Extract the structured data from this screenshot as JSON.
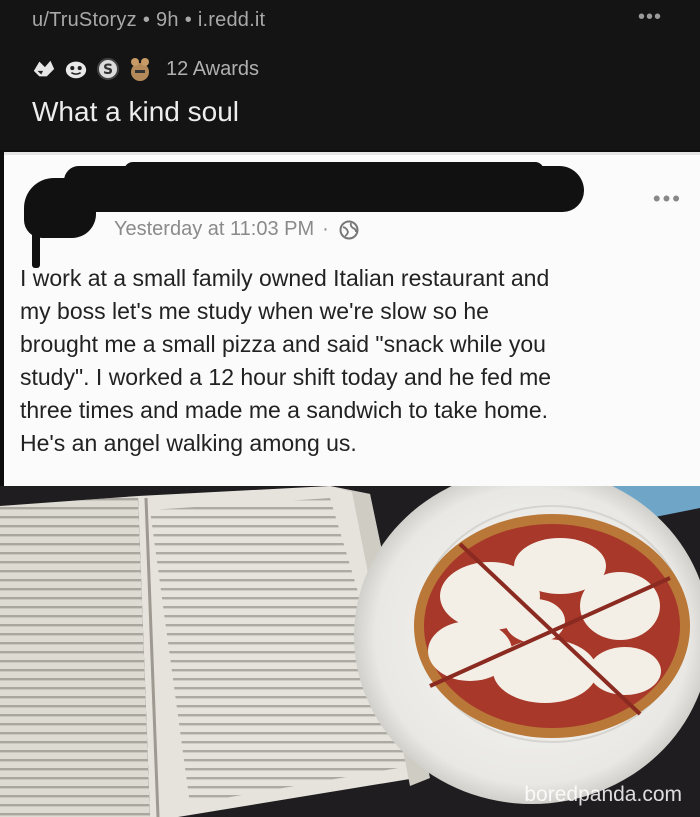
{
  "post": {
    "subreddit_user": "u/TruStoryz",
    "age": "9h",
    "domain": "i.redd.it",
    "awards_label": "12 Awards",
    "title": "What a kind soul",
    "more": "•••"
  },
  "fb_post": {
    "timestamp": "Yesterday at 11:03 PM",
    "separator": "·",
    "more": "•••",
    "body": "I work at a small family owned Italian restaurant and\nmy boss let's me study when we're slow so he\nbrought me a small pizza and said \"snack while you\nstudy\". I worked a 12 hour shift today and he fed me\nthree times and made me a sandwich to take home.\nHe's an angel walking among us."
  },
  "photo": {
    "watermark": "boredpanda.com"
  },
  "icons": [
    "award-icon",
    "award-icon",
    "award-icon",
    "award-icon",
    "globe-icon",
    "more-icon"
  ],
  "colors": {
    "header_bg": "#141414",
    "card_bg": "#fbfbfb",
    "redaction": "#111111"
  }
}
